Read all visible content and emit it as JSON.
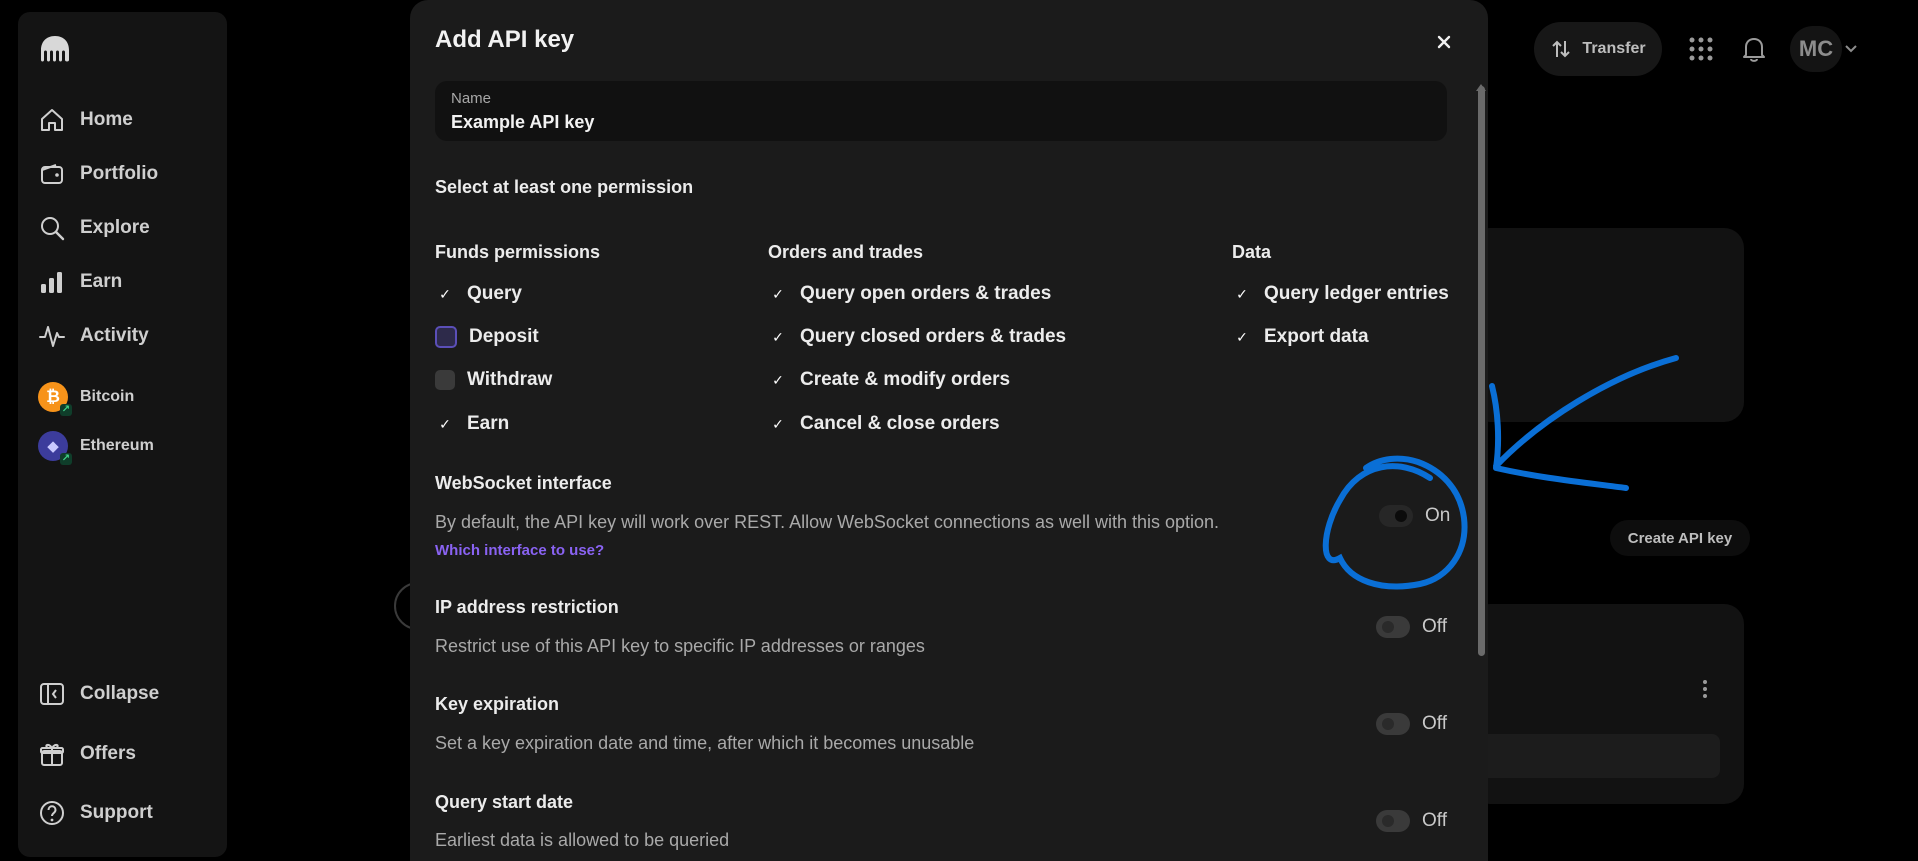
{
  "sidebar": {
    "logo_icon": "kraken-logo",
    "nav": [
      {
        "label": "Home",
        "icon": "home-icon"
      },
      {
        "label": "Portfolio",
        "icon": "wallet-icon"
      },
      {
        "label": "Explore",
        "icon": "search-icon"
      },
      {
        "label": "Earn",
        "icon": "bar-chart-icon"
      },
      {
        "label": "Activity",
        "icon": "activity-icon"
      }
    ],
    "assets": [
      {
        "label": "Bitcoin",
        "color": "#f7931a",
        "glyph": "₿"
      },
      {
        "label": "Ethereum",
        "color": "#3c3c9c",
        "glyph": "◆"
      }
    ],
    "bottom": [
      {
        "label": "Collapse",
        "icon": "collapse-icon"
      },
      {
        "label": "Offers",
        "icon": "gift-icon"
      },
      {
        "label": "Support",
        "icon": "help-icon"
      }
    ]
  },
  "topbar": {
    "transfer_label": "Transfer",
    "avatar_initials": "MC"
  },
  "background": {
    "create_api_key_label": "Create API key"
  },
  "modal": {
    "title": "Add API key",
    "name_field": {
      "label": "Name",
      "value": "Example API key"
    },
    "permission_prompt": "Select at least one permission",
    "columns": [
      {
        "title": "Funds permissions",
        "items": [
          {
            "label": "Query",
            "state": "checked"
          },
          {
            "label": "Deposit",
            "state": "focus"
          },
          {
            "label": "Withdraw",
            "state": "unchecked"
          },
          {
            "label": "Earn",
            "state": "checked"
          }
        ]
      },
      {
        "title": "Orders and trades",
        "items": [
          {
            "label": "Query open orders & trades",
            "state": "checked"
          },
          {
            "label": "Query closed orders & trades",
            "state": "checked"
          },
          {
            "label": "Create & modify orders",
            "state": "checked"
          },
          {
            "label": "Cancel & close orders",
            "state": "checked"
          }
        ]
      },
      {
        "title": "Data",
        "items": [
          {
            "label": "Query ledger entries",
            "state": "checked"
          },
          {
            "label": "Export data",
            "state": "checked"
          }
        ]
      }
    ],
    "options": [
      {
        "title": "WebSocket interface",
        "description": "By default, the API key will work over REST. Allow WebSocket connections as well with this option.",
        "link": "Which interface to use?",
        "toggle_label": "On",
        "on": true
      },
      {
        "title": "IP address restriction",
        "description": "Restrict use of this API key to specific IP addresses or ranges",
        "toggle_label": "Off",
        "on": false
      },
      {
        "title": "Key expiration",
        "description": "Set a key expiration date and time, after which it becomes unusable",
        "toggle_label": "Off",
        "on": false
      },
      {
        "title": "Query start date",
        "description": "Earliest data is allowed to be queried",
        "toggle_label": "Off",
        "on": false
      }
    ]
  },
  "annotation_color": "#0a6fd6"
}
